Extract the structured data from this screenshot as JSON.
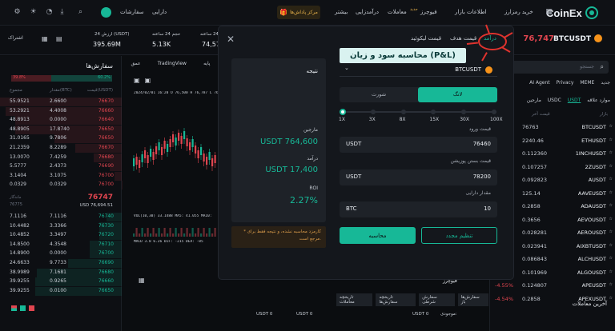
{
  "nav": {
    "brand": "CoinEx",
    "menu": [
      "خرید رمزارز",
      "اطلاعات بازار",
      "فیوچرز",
      "معاملات",
      "درآمدزایی",
      "بیشتر"
    ],
    "badges": [
      "جدید"
    ],
    "promo": "مرکز پاداش‌ها",
    "assets": "سفارشات",
    "wallet": "دارایی"
  },
  "ticker": {
    "symbol": "BTCUSDT",
    "price": "76,747",
    "stats": [
      {
        "label": "قیمت 24 ساعته(BTC)",
        "value": "74,576"
      },
      {
        "label": "حجم 24 ساعته",
        "value": "5.13K"
      },
      {
        "label": "ارزش 24 (USDT)",
        "value": "395.69M"
      }
    ],
    "share_label": "اشتراک"
  },
  "orderbook": {
    "title": "سفارش‌ها",
    "ratio_buy": "60.2%",
    "ratio_sell": "39.8%",
    "headers": [
      "قیمت(USDT)",
      "مقدار(BTC)",
      "مجموع"
    ],
    "asks": [
      [
        "76670",
        "2.6600",
        "55.9521"
      ],
      [
        "76660",
        "4.4008",
        "53.2921"
      ],
      [
        "76640",
        "0.0000",
        "48.8913"
      ],
      [
        "76650",
        "17.8740",
        "48.8905"
      ],
      [
        "76650",
        "9.7806",
        "31.0165"
      ],
      [
        "76670",
        "8.2289",
        "21.2359"
      ],
      [
        "76680",
        "7.4259",
        "13.0070"
      ],
      [
        "76690",
        "2.4373",
        "5.5777"
      ],
      [
        "76700",
        "3.1075",
        "3.1404"
      ],
      [
        "76700",
        "0.0329",
        "0.0329"
      ]
    ],
    "mid_price": "76747",
    "mid_sub": "76775",
    "mid_usd": "USD 76,694.51",
    "mid_label": "ماندگار",
    "bids": [
      [
        "76740",
        "7.1116",
        "7.1116"
      ],
      [
        "76730",
        "3.3366",
        "10.4482"
      ],
      [
        "76720",
        "3.3497",
        "10.4852"
      ],
      [
        "76710",
        "4.3548",
        "14.8500"
      ],
      [
        "76700",
        "0.0000",
        "14.8900"
      ],
      [
        "76690",
        "9.7733",
        "24.6633"
      ],
      [
        "76680",
        "7.1681",
        "38.9989"
      ],
      [
        "76660",
        "0.9265",
        "39.9255"
      ],
      [
        "76650",
        "0.0100",
        "39.9255"
      ]
    ]
  },
  "chart": {
    "tabs": [
      "پایه",
      "TradingView",
      "عمق"
    ],
    "ohlc": "2024/02/01 16:20 O 76,500 H 76,787 L 76,487 C 76,497",
    "vol": "VOL(10,30) 33.1488 MA5: 41.055 MA10:",
    "macd": "MACD 3.8 6.26 DIF: -215 DEA: -85"
  },
  "modal": {
    "tabs": [
      "درآمد",
      "قیمت هدف",
      "قیمت لیکوئید"
    ],
    "tooltip": "محاسبه سود و زیان (P&L)",
    "pair": "BTCUSDT",
    "side_long": "لانگ",
    "side_short": "شورت",
    "leverage_marks": [
      "1X",
      "3X",
      "8X",
      "15X",
      "30X",
      "100X"
    ],
    "leverage_fraction": 0,
    "entry_label": "قیمت ورود",
    "entry_value": "76460",
    "entry_unit": "USDT",
    "exit_label": "قیمت بستن پوزیشن",
    "exit_value": "78200",
    "exit_unit": "USDT",
    "qty_label": "مقدار دارایی",
    "qty_value": "10",
    "qty_unit": "BTC",
    "reset_label": "تنظیم مجدد",
    "calc_label": "محاسبه",
    "result_title": "نتیجه",
    "margin_label": "مارجین",
    "margin_value": "USDT 764,600",
    "pnl_label": "درآمد",
    "pnl_value": "USDT 17,400",
    "roi_label": "ROI",
    "roi_value": "2.27%",
    "note": "* کارمزد محاسبه نشده، و نتیجه فقط برای مرجع است."
  },
  "markets": {
    "search_placeholder": "جستجو",
    "filters": [
      "جدید",
      "MEME",
      "Privacy",
      "AI Agent"
    ],
    "tabs": [
      "موارد علاقه",
      "USDT",
      "USDC",
      "مارجین"
    ],
    "headers": [
      "بازار",
      "قیمت آخر",
      "تغییر 24"
    ],
    "rows": [
      [
        "BTCUSDT",
        "76763",
        "-2.28%"
      ],
      [
        "ETHUSDT",
        "2240.46",
        "-5.31%"
      ],
      [
        "1INCHUSDT",
        "0.112360",
        "-5.55%"
      ],
      [
        "2ZUSDT",
        "0.107257",
        "-4.80%"
      ],
      [
        "AUSDT",
        "0.092823",
        "-6.64%"
      ],
      [
        "AAVEUSDT",
        "125.14",
        "-6.37%"
      ],
      [
        "ADAUSDT",
        "0.2858",
        "-7.72%"
      ],
      [
        "AEVOUSDT",
        "0.3656",
        "-4.64%"
      ],
      [
        "AEROUSDT",
        "0.028281",
        "-4.10%"
      ],
      [
        "AIXBTUSDT",
        "0.023941",
        "-5.43%"
      ],
      [
        "ALCHUSDT",
        "0.086843",
        "-6.28%"
      ],
      [
        "ALGOUSDT",
        "0.101969",
        "-6.19%"
      ],
      [
        "APEUSDT",
        "0.124807",
        "-4.55%"
      ],
      [
        "APEXUSDT",
        "0.2858",
        "-4.54%"
      ]
    ],
    "recent_trades": "آخرین معاملات"
  },
  "bottom": {
    "tabs": [
      "سفارش‌ها باز",
      "سفارش شرطی",
      "تاریخچه سفارش‌ها",
      "تاریخچه معاملات"
    ],
    "futures_label": "فیوچرز",
    "balance": "USDT 0",
    "balance_label": "موجودی:"
  },
  "colors": {
    "accent": "#17b897",
    "down": "#e0454f",
    "annotation": "#e0332e"
  }
}
